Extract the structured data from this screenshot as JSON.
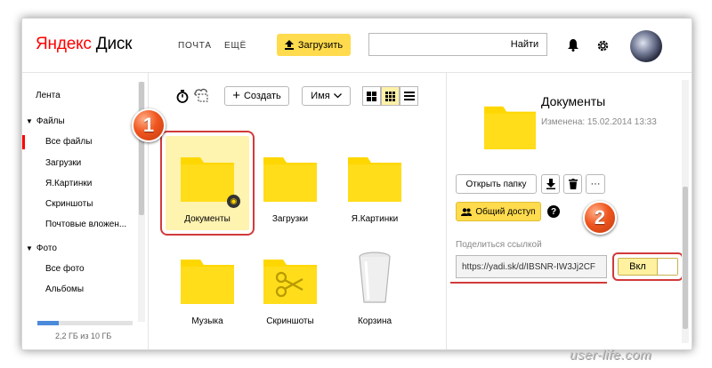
{
  "header": {
    "logo_brand": "Яндекс",
    "logo_product": "Диск",
    "nav_mail": "ПОЧТА",
    "nav_more": "ЕЩЁ",
    "upload_label": "Загрузить",
    "search_placeholder": "",
    "search_button": "Найти"
  },
  "sidebar": {
    "feed": "Лента",
    "files_section": "Файлы",
    "files": [
      "Все файлы",
      "Загрузки",
      "Я.Картинки",
      "Скриншоты",
      "Почтовые вложен..."
    ],
    "photo_section": "Фото",
    "photos": [
      "Все фото",
      "Альбомы"
    ],
    "quota_text": "2,2 ГБ из 10 ГБ",
    "quota_fraction": 0.22
  },
  "toolbar": {
    "create_label": "Создать",
    "sort_label": "Имя"
  },
  "files": [
    {
      "name": "Документы",
      "type": "folder",
      "shared": true,
      "selected": true
    },
    {
      "name": "Загрузки",
      "type": "folder"
    },
    {
      "name": "Я.Картинки",
      "type": "folder"
    },
    {
      "name": "Музыка",
      "type": "folder"
    },
    {
      "name": "Скриншоты",
      "type": "folder-scissors"
    },
    {
      "name": "Корзина",
      "type": "trash"
    }
  ],
  "panel": {
    "title": "Документы",
    "modified": "Изменена: 15.02.2014 13:33",
    "open_folder": "Открыть папку",
    "more": "···",
    "shared_access": "Общий доступ",
    "share_link_label": "Поделиться ссылкой",
    "share_url": "https://yadi.sk/d/IBSNR-IW3Jj2CF",
    "toggle_label": "Вкл"
  },
  "annotations": {
    "badge1": "1",
    "badge2": "2"
  },
  "watermark": "user-life.com",
  "colors": {
    "accent_yellow": "#ffdb4d",
    "folder_yellow": "#ffd700",
    "highlight_red": "#d23a3a",
    "brand_red": "#ff0000"
  }
}
